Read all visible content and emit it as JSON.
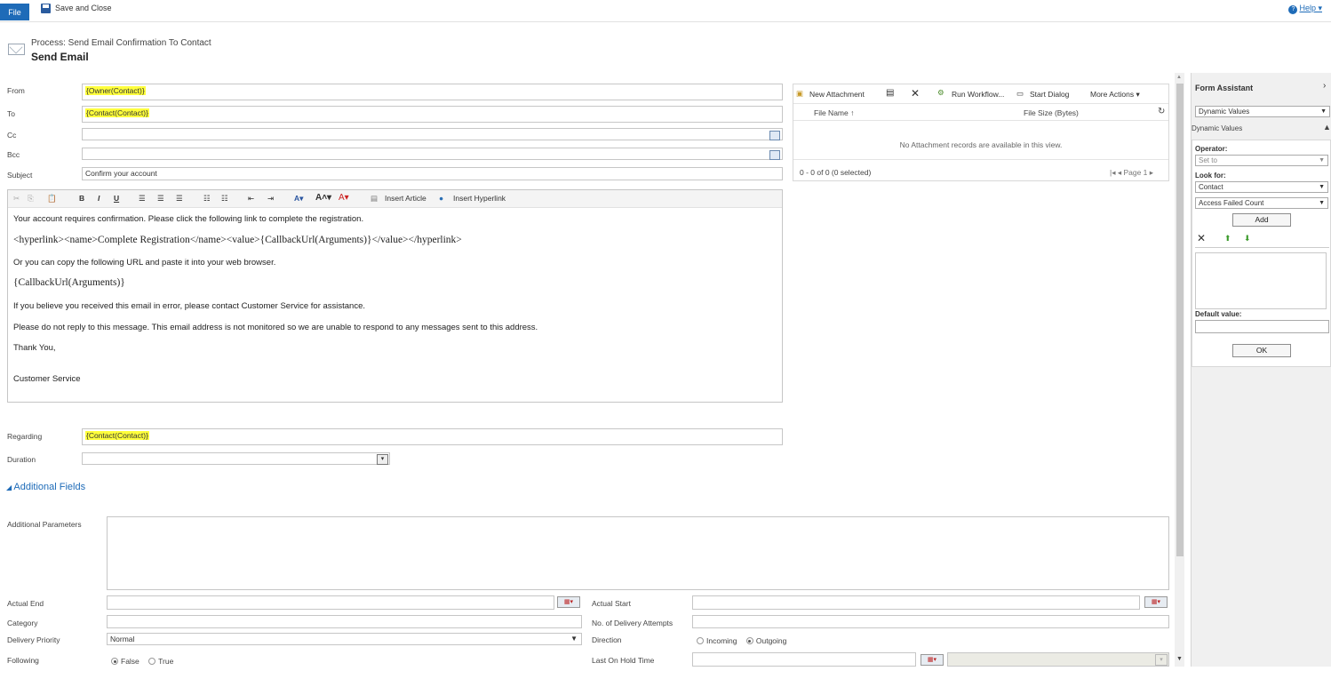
{
  "ribbon": {
    "file_label": "File",
    "save_close_label": "Save and Close",
    "help_label": "Help ▾"
  },
  "header": {
    "process_label": "Process: Send Email Confirmation To Contact",
    "title": "Send Email"
  },
  "fields": {
    "from_label": "From",
    "from_value": "{Owner(Contact)}",
    "to_label": "To",
    "to_value": "{Contact(Contact)}",
    "cc_label": "Cc",
    "bcc_label": "Bcc",
    "subject_label": "Subject",
    "subject_value": "Confirm your account",
    "regarding_label": "Regarding",
    "regarding_value": "{Contact(Contact)}",
    "duration_label": "Duration"
  },
  "editor": {
    "toolbar": {
      "insert_article": "Insert Article",
      "insert_hyperlink": "Insert Hyperlink"
    },
    "lines": [
      "Your account requires confirmation. Please click the following link to complete the registration.",
      "<hyperlink><name>Complete Registration</name><value>{CallbackUrl(Arguments)}</value></hyperlink>",
      "Or you can copy the following URL and paste it into your web browser.",
      "{CallbackUrl(Arguments)}",
      "If you believe you received this email in error, please contact Customer Service for assistance.",
      "Please do not reply to this message. This email address is not monitored so we are unable to respond to any messages sent to this address.",
      "Thank You,",
      "Customer Service"
    ]
  },
  "attachments": {
    "toolbar": {
      "new_attachment": "New Attachment",
      "run_workflow": "Run Workflow...",
      "start_dialog": "Start Dialog",
      "more_actions": "More Actions ▾"
    },
    "columns": {
      "file_name": "File Name ↑",
      "file_size": "File Size (Bytes)"
    },
    "empty_message": "No Attachment records are available in this view.",
    "status": "0 - 0 of 0 (0 selected)",
    "page": "Page 1"
  },
  "additional": {
    "section_title": "Additional Fields",
    "additional_parameters_label": "Additional Parameters",
    "actual_end_label": "Actual End",
    "actual_start_label": "Actual Start",
    "category_label": "Category",
    "delivery_attempts_label": "No. of Delivery Attempts",
    "delivery_priority_label": "Delivery Priority",
    "delivery_priority_value": "Normal",
    "direction_label": "Direction",
    "direction_incoming": "Incoming",
    "direction_outgoing": "Outgoing",
    "following_label": "Following",
    "following_false": "False",
    "following_true": "True",
    "last_on_hold_label": "Last On Hold Time"
  },
  "form_assistant": {
    "title": "Form Assistant",
    "dropdown_value": "Dynamic Values",
    "section_label": "Dynamic Values",
    "operator_label": "Operator:",
    "operator_value": "Set to",
    "look_for_label": "Look for:",
    "look_for_value": "Contact",
    "attribute_value": "Access Failed Count",
    "add_label": "Add",
    "default_value_label": "Default value:",
    "ok_label": "OK"
  }
}
